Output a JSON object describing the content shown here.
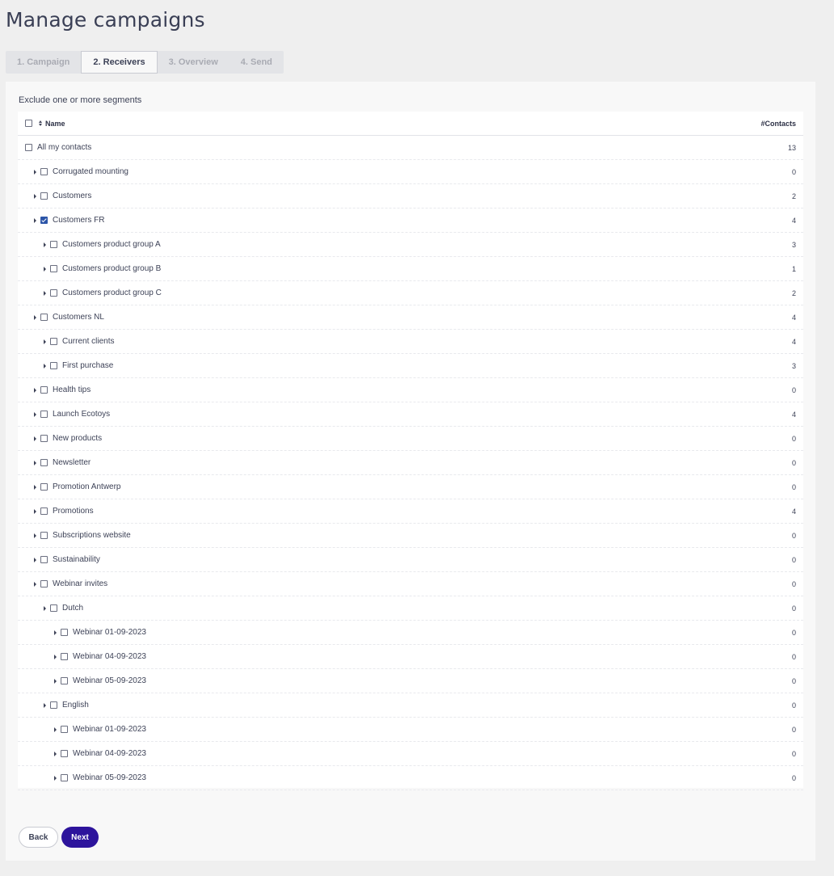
{
  "page": {
    "title": "Manage campaigns"
  },
  "steps": [
    {
      "label": "1. Campaign",
      "state": "inactive"
    },
    {
      "label": "2. Receivers",
      "state": "active"
    },
    {
      "label": "3. Overview",
      "state": "inactive"
    },
    {
      "label": "4. Send",
      "state": "inactive"
    }
  ],
  "section": {
    "label": "Exclude one or more segments"
  },
  "table": {
    "headers": {
      "name": "Name",
      "contacts": "#Contacts"
    },
    "rows": [
      {
        "label": "All my contacts",
        "count": "13",
        "level": 0,
        "expandable": false,
        "checked": false
      },
      {
        "label": "Corrugated mounting",
        "count": "0",
        "level": 1,
        "expandable": true,
        "checked": false
      },
      {
        "label": "Customers",
        "count": "2",
        "level": 1,
        "expandable": true,
        "checked": false
      },
      {
        "label": "Customers FR",
        "count": "4",
        "level": 1,
        "expandable": true,
        "checked": true
      },
      {
        "label": "Customers product group A",
        "count": "3",
        "level": 2,
        "expandable": true,
        "checked": false
      },
      {
        "label": "Customers product group B",
        "count": "1",
        "level": 2,
        "expandable": true,
        "checked": false
      },
      {
        "label": "Customers product group C",
        "count": "2",
        "level": 2,
        "expandable": true,
        "checked": false
      },
      {
        "label": "Customers NL",
        "count": "4",
        "level": 1,
        "expandable": true,
        "checked": false
      },
      {
        "label": "Current clients",
        "count": "4",
        "level": 2,
        "expandable": true,
        "checked": false
      },
      {
        "label": "First purchase",
        "count": "3",
        "level": 2,
        "expandable": true,
        "checked": false
      },
      {
        "label": "Health tips",
        "count": "0",
        "level": 1,
        "expandable": true,
        "checked": false
      },
      {
        "label": "Launch Ecotoys",
        "count": "4",
        "level": 1,
        "expandable": true,
        "checked": false
      },
      {
        "label": "New products",
        "count": "0",
        "level": 1,
        "expandable": true,
        "checked": false
      },
      {
        "label": "Newsletter",
        "count": "0",
        "level": 1,
        "expandable": true,
        "checked": false
      },
      {
        "label": "Promotion Antwerp",
        "count": "0",
        "level": 1,
        "expandable": true,
        "checked": false
      },
      {
        "label": "Promotions",
        "count": "4",
        "level": 1,
        "expandable": true,
        "checked": false
      },
      {
        "label": "Subscriptions website",
        "count": "0",
        "level": 1,
        "expandable": true,
        "checked": false
      },
      {
        "label": "Sustainability",
        "count": "0",
        "level": 1,
        "expandable": true,
        "checked": false
      },
      {
        "label": "Webinar invites",
        "count": "0",
        "level": 1,
        "expandable": true,
        "checked": false
      },
      {
        "label": "Dutch",
        "count": "0",
        "level": 2,
        "expandable": true,
        "checked": false
      },
      {
        "label": "Webinar 01-09-2023",
        "count": "0",
        "level": 3,
        "expandable": true,
        "checked": false
      },
      {
        "label": "Webinar 04-09-2023",
        "count": "0",
        "level": 3,
        "expandable": true,
        "checked": false
      },
      {
        "label": "Webinar 05-09-2023",
        "count": "0",
        "level": 3,
        "expandable": true,
        "checked": false
      },
      {
        "label": "English",
        "count": "0",
        "level": 2,
        "expandable": true,
        "checked": false
      },
      {
        "label": "Webinar 01-09-2023",
        "count": "0",
        "level": 3,
        "expandable": true,
        "checked": false
      },
      {
        "label": "Webinar 04-09-2023",
        "count": "0",
        "level": 3,
        "expandable": true,
        "checked": false
      },
      {
        "label": "Webinar 05-09-2023",
        "count": "0",
        "level": 3,
        "expandable": true,
        "checked": false
      }
    ]
  },
  "buttons": {
    "back": "Back",
    "next": "Next"
  },
  "colors": {
    "primary": "#2d149c",
    "checkbox_checked": "#2c55a8",
    "text": "#3d4257"
  },
  "icons": {
    "expand": "caret-right-icon",
    "sort": "sort-icon"
  }
}
